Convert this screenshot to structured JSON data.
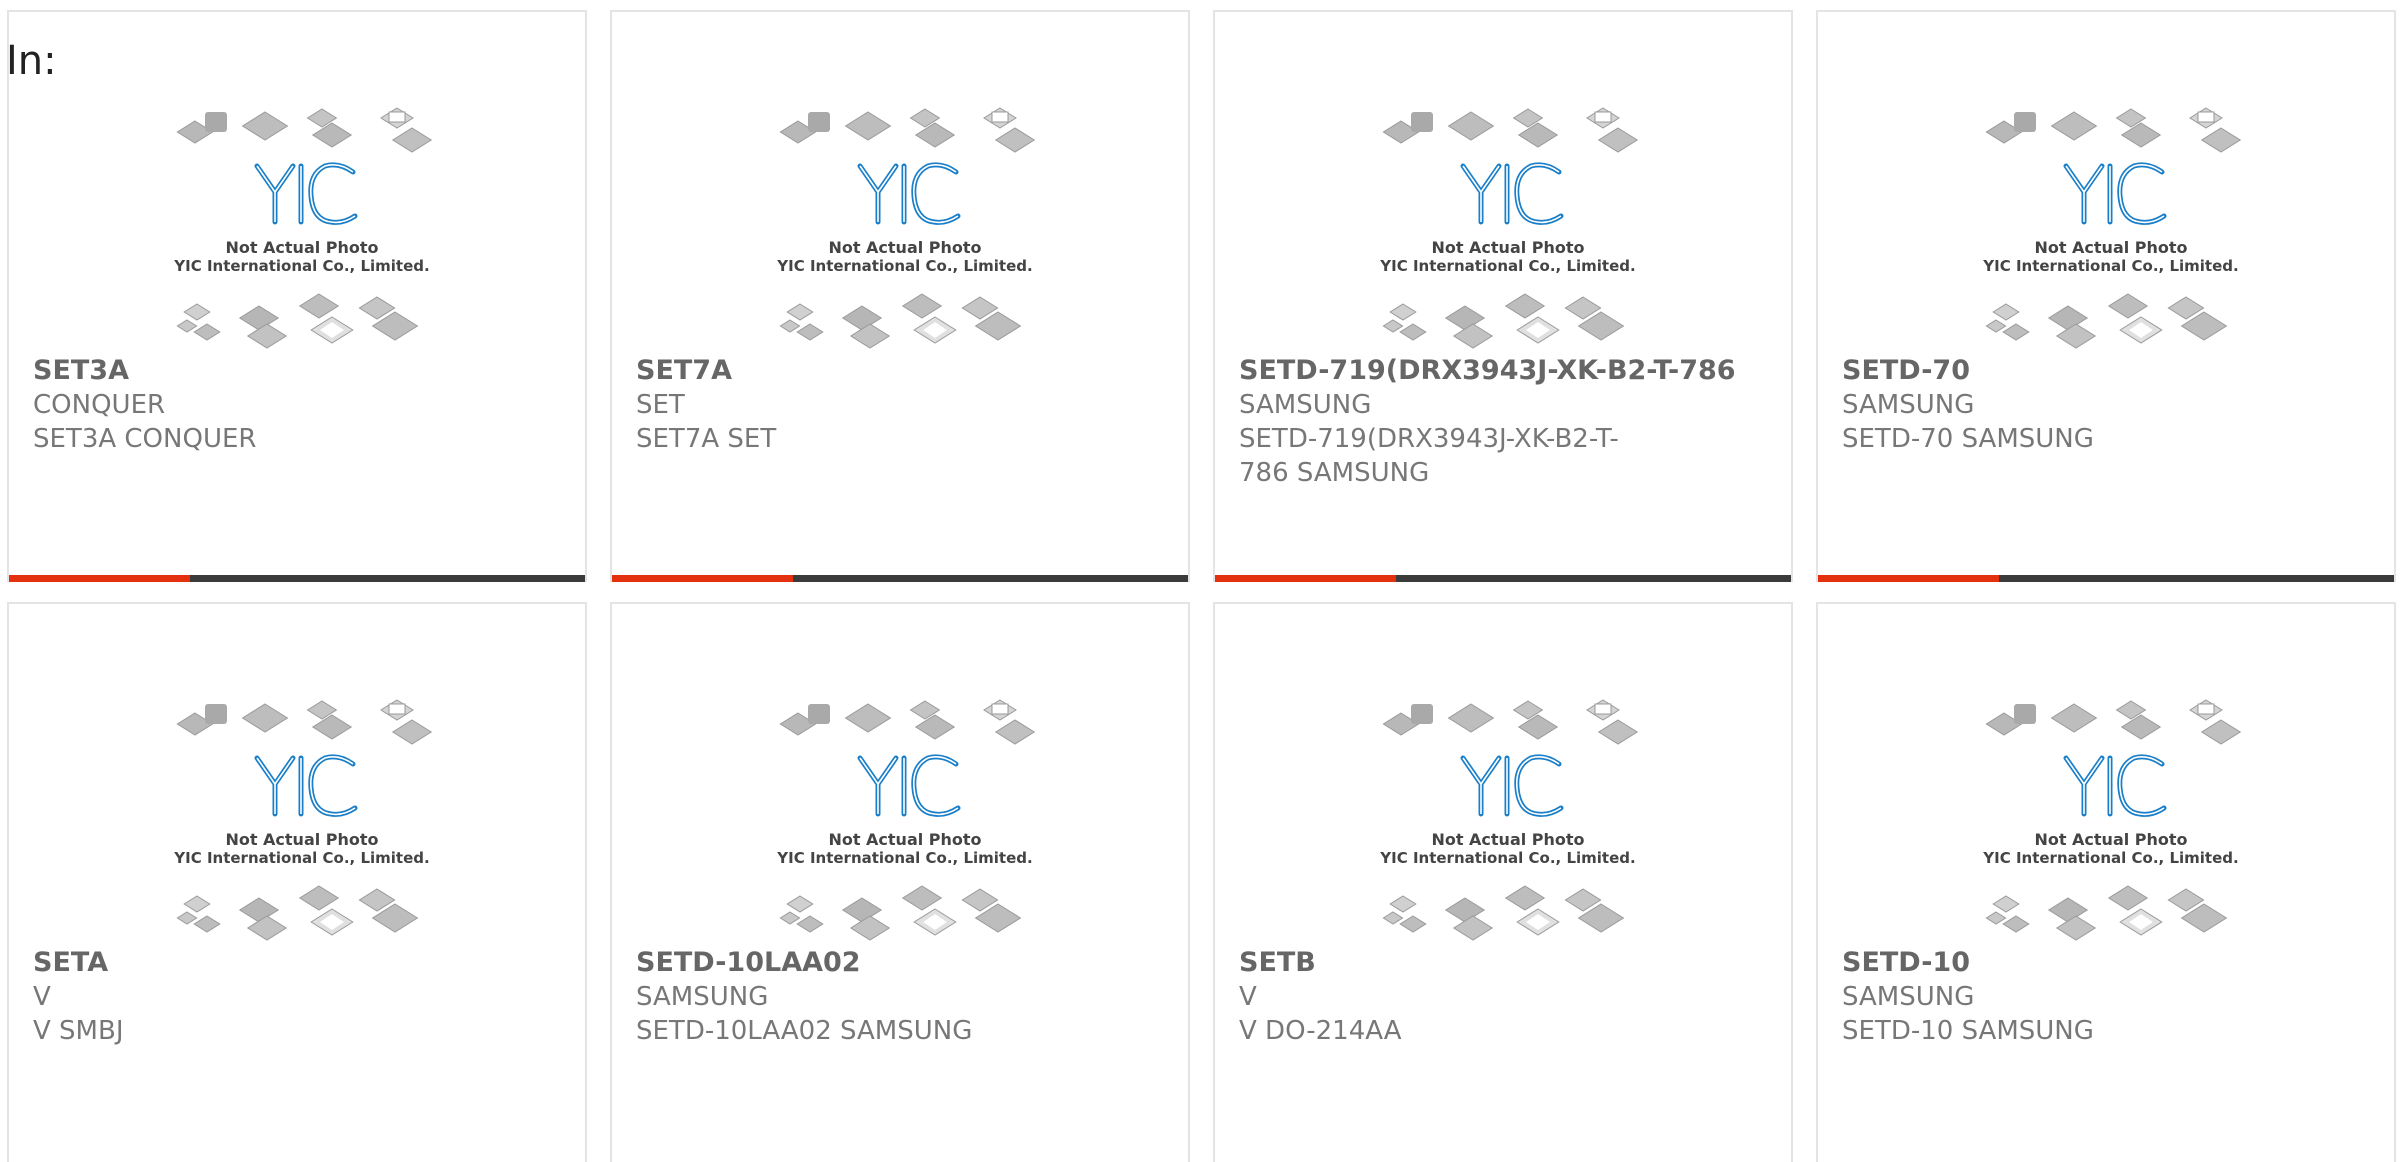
{
  "header": {
    "label": "In:"
  },
  "thumbnail": {
    "caption_line1": "Not Actual Photo",
    "caption_line2": "YIC International Co., Limited.",
    "logo_text": "YIC",
    "icon": "chip-placeholder-image"
  },
  "colors": {
    "accent": "#e3300f",
    "bar": "#3b3b3b",
    "logo": "#1a7fc8"
  },
  "products": [
    {
      "part_number": "SET3A",
      "manufacturer": "CONQUER",
      "description": "SET3A CONQUER"
    },
    {
      "part_number": "SET7A",
      "manufacturer": "SET",
      "description": "SET7A SET"
    },
    {
      "part_number": "SETD-719(DRX3943J-XK-B2-T-786",
      "manufacturer": "SAMSUNG",
      "description": "SETD-719(DRX3943J-XK-B2-T-786 SAMSUNG"
    },
    {
      "part_number": "SETD-70",
      "manufacturer": "SAMSUNG",
      "description": "SETD-70 SAMSUNG"
    },
    {
      "part_number": "SETA",
      "manufacturer": "V",
      "description": "V SMBJ"
    },
    {
      "part_number": "SETD-10LAA02",
      "manufacturer": "SAMSUNG",
      "description": "SETD-10LAA02 SAMSUNG"
    },
    {
      "part_number": "SETB",
      "manufacturer": "V",
      "description": "V DO-214AA"
    },
    {
      "part_number": "SETD-10",
      "manufacturer": "SAMSUNG",
      "description": "SETD-10 SAMSUNG"
    }
  ]
}
